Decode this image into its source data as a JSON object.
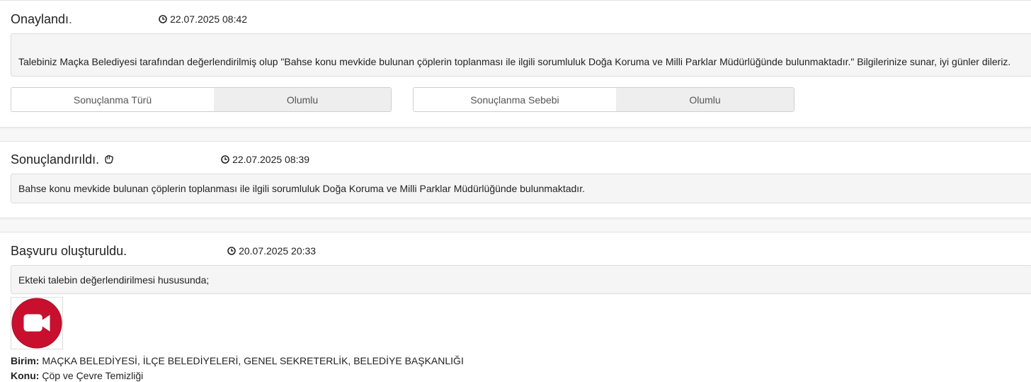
{
  "entries": [
    {
      "status": "Onaylandı.",
      "timestamp": "22.07.2025 08:42",
      "message": "Talebiniz Maçka Belediyesi tarafından değerlendirilmiş olup \"Bahse konu mevkide bulunan çöplerin toplanması ile ilgili sorumluluk Doğa Koruma ve Milli Parklar Müdürlüğünde bulunmaktadır.\" Bilgilerinize sunar, iyi günler dileriz.",
      "results": [
        {
          "label": "Sonuçlanma Türü",
          "value": "Olumlu"
        },
        {
          "label": "Sonuçlanma Sebebi",
          "value": "Olumlu"
        }
      ]
    },
    {
      "status": "Sonuçlandırıldı.",
      "timestamp": "22.07.2025 08:39",
      "message": "Bahse konu mevkide bulunan çöplerin toplanması ile ilgili sorumluluk Doğa Koruma ve Milli Parklar Müdürlüğünde bulunmaktadır."
    },
    {
      "status": "Başvuru oluşturuldu.",
      "timestamp": "20.07.2025 20:33",
      "message": "Ekteki talebin değerlendirilmesi hususunda;",
      "attachment_icon": "video-camera-icon",
      "birim_label": "Birim:",
      "birim_value": "MAÇKA BELEDİYESİ, İLÇE BELEDİYELERİ, GENEL SEKRETERLİK, BELEDİYE BAŞKANLIĞI",
      "konu_label": "Konu:",
      "konu_value": "Çöp ve Çevre Temizliği"
    }
  ],
  "colors": {
    "attachment_red": "#c8102e",
    "box_background": "#f5f5f5",
    "result_value_background": "#eeeeee"
  }
}
